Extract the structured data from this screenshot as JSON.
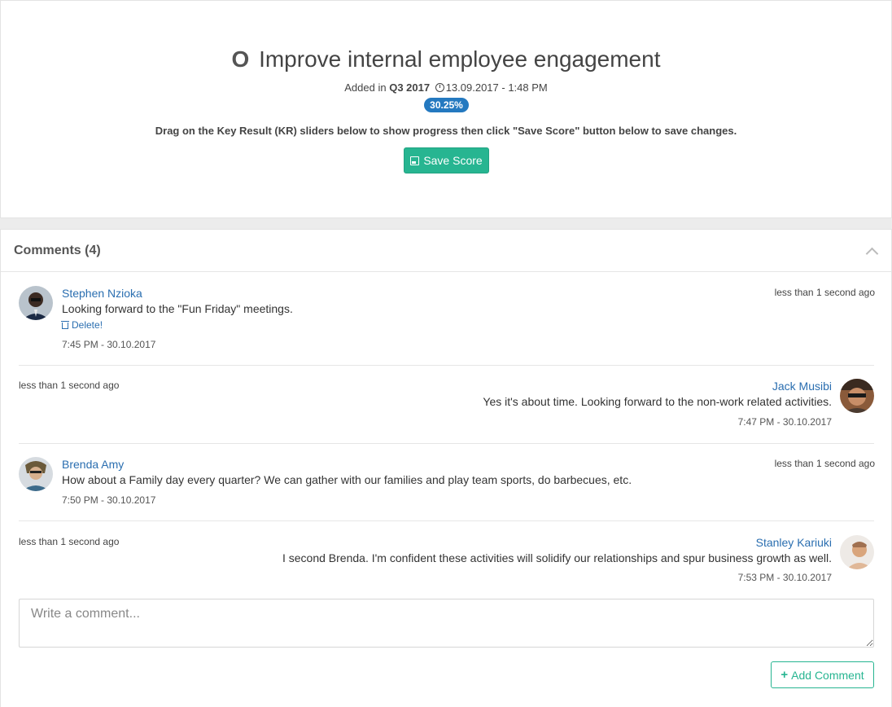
{
  "objective": {
    "prefix": "O",
    "title": "Improve internal employee engagement",
    "added_in_label": "Added in",
    "quarter": "Q3 2017",
    "datetime": "13.09.2017 - 1:48 PM",
    "progress": "30.25%",
    "instructions": "Drag on the Key Result (KR) sliders below to show progress then click \"Save Score\" button below to save changes.",
    "save_label": "Save Score"
  },
  "comments": {
    "title": "Comments (4)",
    "items": [
      {
        "author": "Stephen Nzioka",
        "text": "Looking forward to the \"Fun Friday\" meetings.",
        "delete_label": "Delete!",
        "time": "7:45 PM - 30.10.2017",
        "ago": "less than 1 second ago"
      },
      {
        "author": "Jack Musibi",
        "text": "Yes it's about time. Looking forward to the non-work related activities.",
        "time": "7:47 PM - 30.10.2017",
        "ago": "less than 1 second ago"
      },
      {
        "author": "Brenda Amy",
        "text": "How about a Family day every quarter? We can gather with our families and play team sports, do barbecues, etc.",
        "time": "7:50 PM - 30.10.2017",
        "ago": "less than 1 second ago"
      },
      {
        "author": "Stanley Kariuki",
        "text": "I second Brenda. I'm confident these activities will solidify our relationships and spur business growth as well.",
        "time": "7:53 PM - 30.10.2017",
        "ago": "less than 1 second ago"
      }
    ],
    "input_placeholder": "Write a comment...",
    "add_label": "Add Comment"
  },
  "colors": {
    "accent_green": "#27b591",
    "link_blue": "#2a6eb0",
    "badge_blue": "#2479c0"
  }
}
